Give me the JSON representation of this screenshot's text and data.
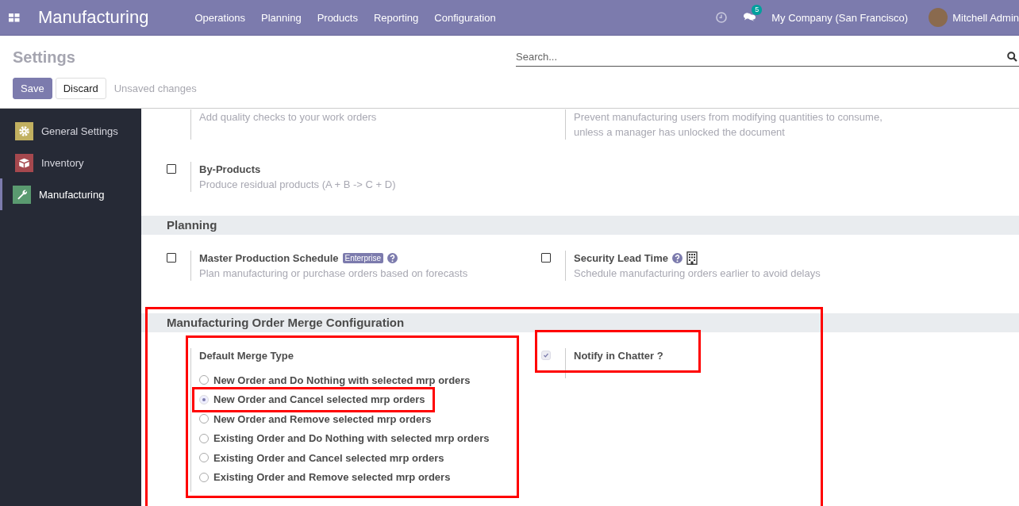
{
  "navbar": {
    "app_title": "Manufacturing",
    "menus": [
      "Operations",
      "Planning",
      "Products",
      "Reporting",
      "Configuration"
    ],
    "messages_badge": "5",
    "company": "My Company (San Francisco)",
    "user": "Mitchell Admin"
  },
  "control_panel": {
    "title": "Settings",
    "search": {
      "placeholder": "Search..."
    },
    "buttons": [
      {
        "label": "Save",
        "kind": "primary"
      },
      {
        "label": "Discard",
        "kind": "secondary"
      }
    ],
    "status": "Unsaved changes"
  },
  "sidebar": {
    "items": [
      {
        "label": "General Settings",
        "selected": false,
        "color": "#c1b060"
      },
      {
        "label": "Inventory",
        "selected": false,
        "color": "#a5484e"
      },
      {
        "label": "Manufacturing",
        "selected": true,
        "color": "#5a9a70"
      }
    ]
  },
  "sections": [
    {
      "settings": [
        {
          "kind": "partial",
          "description": "Add quality checks to your work orders"
        },
        {
          "kind": "partial",
          "description": "Prevent manufacturing users from modifying quantities to consume, unless a manager has unlocked the document"
        },
        {
          "kind": "checkbox",
          "title": "By-Products",
          "description": "Produce residual products (A + B -> C + D)",
          "checked": false
        }
      ]
    },
    {
      "title": "Planning",
      "settings": [
        {
          "kind": "checkbox",
          "title": "Master Production Schedule",
          "badge": "Enterprise",
          "help": true,
          "description": "Plan manufacturing or purchase orders based on forecasts",
          "checked": false
        },
        {
          "kind": "checkbox",
          "title": "Security Lead Time",
          "help": true,
          "company_icon": true,
          "description": "Schedule manufacturing orders earlier to avoid delays",
          "checked": false
        }
      ]
    },
    {
      "title": "Manufacturing Order Merge Configuration",
      "highlighted": true,
      "settings": [
        {
          "kind": "radio",
          "title": "Default Merge Type",
          "highlighted": true,
          "options": [
            {
              "label": "New Order and Do Nothing with selected mrp orders",
              "selected": false,
              "highlighted": false
            },
            {
              "label": "New Order and Cancel selected mrp orders",
              "selected": true,
              "highlighted": true
            },
            {
              "label": "New Order and Remove selected mrp orders",
              "selected": false,
              "highlighted": false
            },
            {
              "label": "Existing Order and Do Nothing with selected mrp orders",
              "selected": false,
              "highlighted": false
            },
            {
              "label": "Existing Order and Cancel selected mrp orders",
              "selected": false,
              "highlighted": false
            },
            {
              "label": "Existing Order and Remove selected mrp orders",
              "selected": false,
              "highlighted": false
            }
          ]
        },
        {
          "kind": "checkbox",
          "title": "Notify in Chatter ?",
          "checked": true,
          "readonly": true,
          "highlighted": true
        }
      ]
    }
  ]
}
